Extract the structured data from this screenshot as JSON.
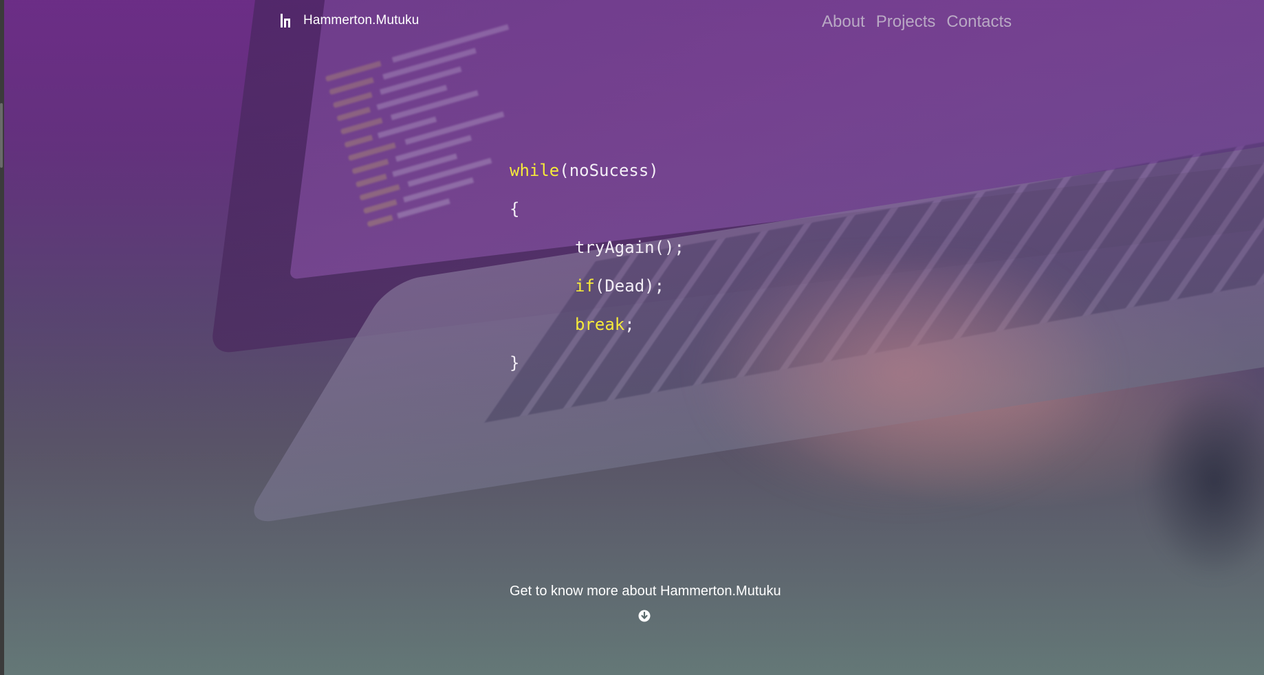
{
  "brand": {
    "name": "Hammerton.Mutuku",
    "logo_icon": "h-logo-icon"
  },
  "nav": {
    "items": [
      {
        "label": "About"
      },
      {
        "label": "Projects"
      },
      {
        "label": "Contacts"
      }
    ]
  },
  "code": {
    "line1_kw": "while",
    "line1_rest": "(noSucess)",
    "line2": "{",
    "line3": "tryAgain();",
    "line4_kw": "if",
    "line4_rest": "(Dead);",
    "line5_kw": "break",
    "line5_rest": ";",
    "line6": "}"
  },
  "cta": {
    "text": "Get to know more about Hammerton.Mutuku",
    "icon": "arrow-down-circle-icon"
  },
  "colors": {
    "keyword": "#f5e93a",
    "text": "#f3eef6",
    "nav_link": "#b9a9c4",
    "hero_tint": "#6a2e83"
  }
}
